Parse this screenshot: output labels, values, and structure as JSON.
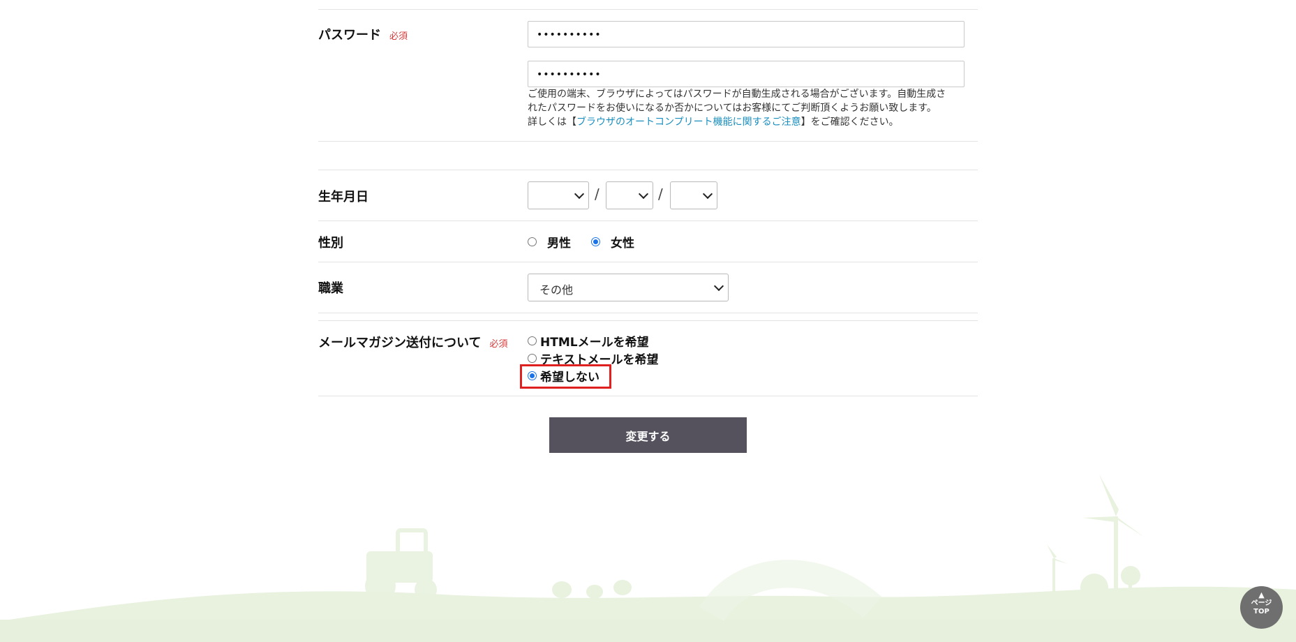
{
  "password": {
    "label": "パスワード",
    "required": "必須",
    "value1": "••••••••••",
    "value2": "••••••••••",
    "note_line1": "ご使用の端末、ブラウザによってはパスワードが自動生成される場合がございます。自動生成さ",
    "note_line2": "れたパスワードをお使いになるか否かについてはお客様にてご判断頂くようお願い致します。",
    "note_line3_prefix": "詳しくは【",
    "note_link": "ブラウザのオートコンプリート機能に関するご注意",
    "note_line3_suffix": "】をご確認ください。"
  },
  "birthday": {
    "label": "生年月日",
    "year": "",
    "month": "",
    "day": "",
    "separator": "/"
  },
  "gender": {
    "label": "性別",
    "options": [
      "男性",
      "女性"
    ],
    "selected": "女性"
  },
  "occupation": {
    "label": "職業",
    "selected": "その他"
  },
  "newsletter": {
    "label": "メールマガジン送付について",
    "required": "必須",
    "options": [
      "HTMLメールを希望",
      "テキストメールを希望",
      "希望しない"
    ],
    "selected": "希望しない"
  },
  "submit": {
    "label": "変更する"
  },
  "page_top": {
    "arrow": "▲",
    "line1": "ページ",
    "line2": "TOP"
  },
  "colors": {
    "required": "#d63a3a",
    "link": "#1a8fbf",
    "button": "#55525d",
    "highlight": "#e02020",
    "footer_green": "#e8f2df"
  }
}
